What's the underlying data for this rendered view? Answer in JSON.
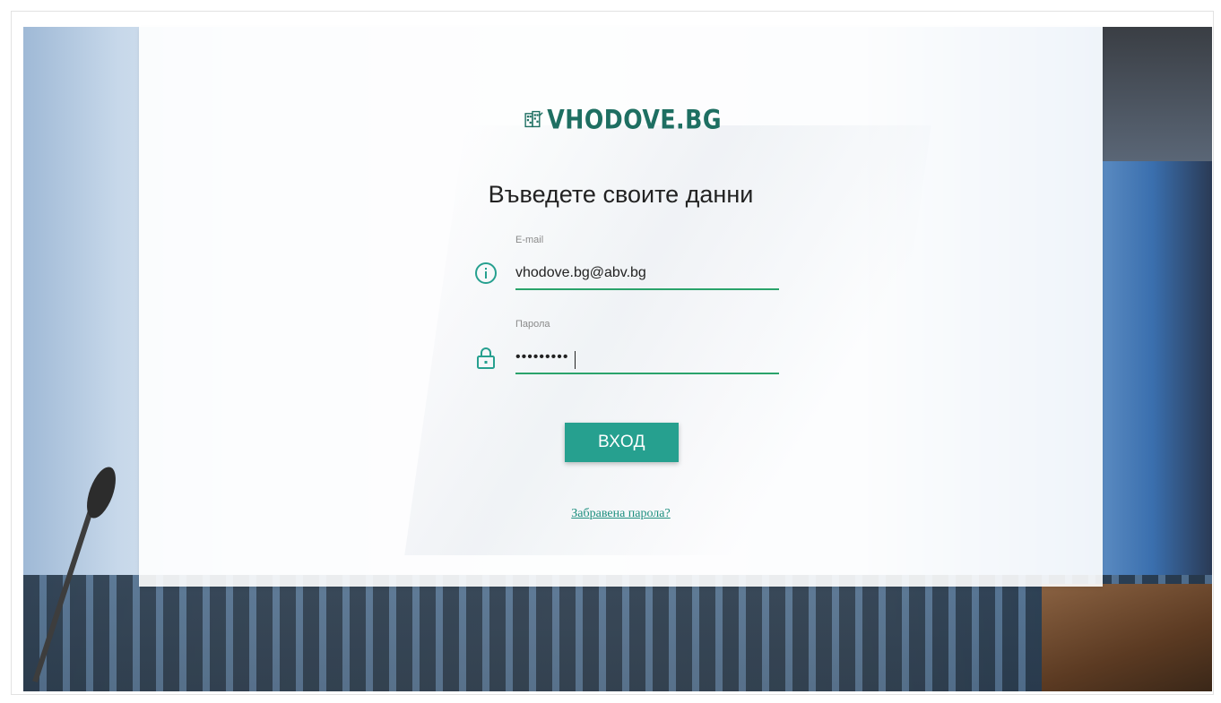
{
  "brand": {
    "name": "VHODOVE.BG",
    "primary_color": "#1e6f62",
    "accent_color": "#26a08f",
    "field_underline_color": "#2aa36b"
  },
  "login": {
    "heading": "Въведете своите данни",
    "email": {
      "label": "E-mail",
      "value": "vhodove.bg@abv.bg",
      "icon": "info-icon"
    },
    "password": {
      "label": "Парола",
      "value": "•••••••••",
      "icon": "lock-icon"
    },
    "submit_label": "ВХОД",
    "forgot_label": "Забравена парола?"
  }
}
